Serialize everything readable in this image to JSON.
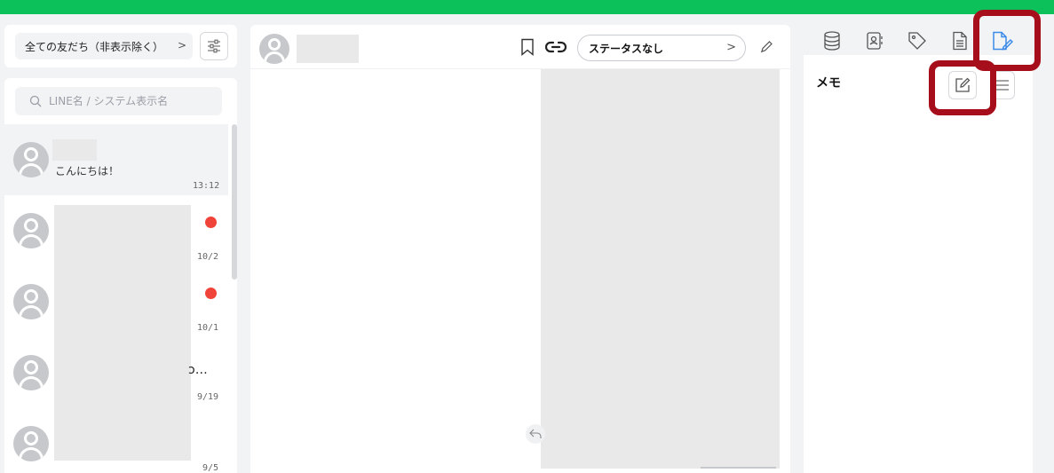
{
  "filter": {
    "label": "全ての友だち（非表示除く）",
    "chevron": ">"
  },
  "search": {
    "placeholder": "LINE名 / システム表示名"
  },
  "chats": [
    {
      "preview": "こんにちは！",
      "time": "13:12"
    },
    {
      "time": "10/2",
      "unread": true
    },
    {
      "time": "10/1",
      "unread": true
    },
    {
      "preview": "ɔ…",
      "time": "9/19"
    },
    {
      "time": "9/5"
    }
  ],
  "chat_header": {
    "status_label": "ステータスなし",
    "status_chevron": ">"
  },
  "right_panel": {
    "memo_title": "メモ"
  },
  "colors": {
    "brand_green": "#0cc05a",
    "unread_red": "#f0433a",
    "highlight_red": "#a70e1b",
    "active_tab_blue": "#3b8be8"
  },
  "icons": [
    "search-icon",
    "filter-settings-icon",
    "bookmark-icon",
    "link-icon",
    "pencil-icon",
    "reply-icon",
    "database-icon",
    "contact-card-icon",
    "tag-icon",
    "document-icon",
    "memo-icon",
    "edit-icon",
    "list-icon"
  ]
}
